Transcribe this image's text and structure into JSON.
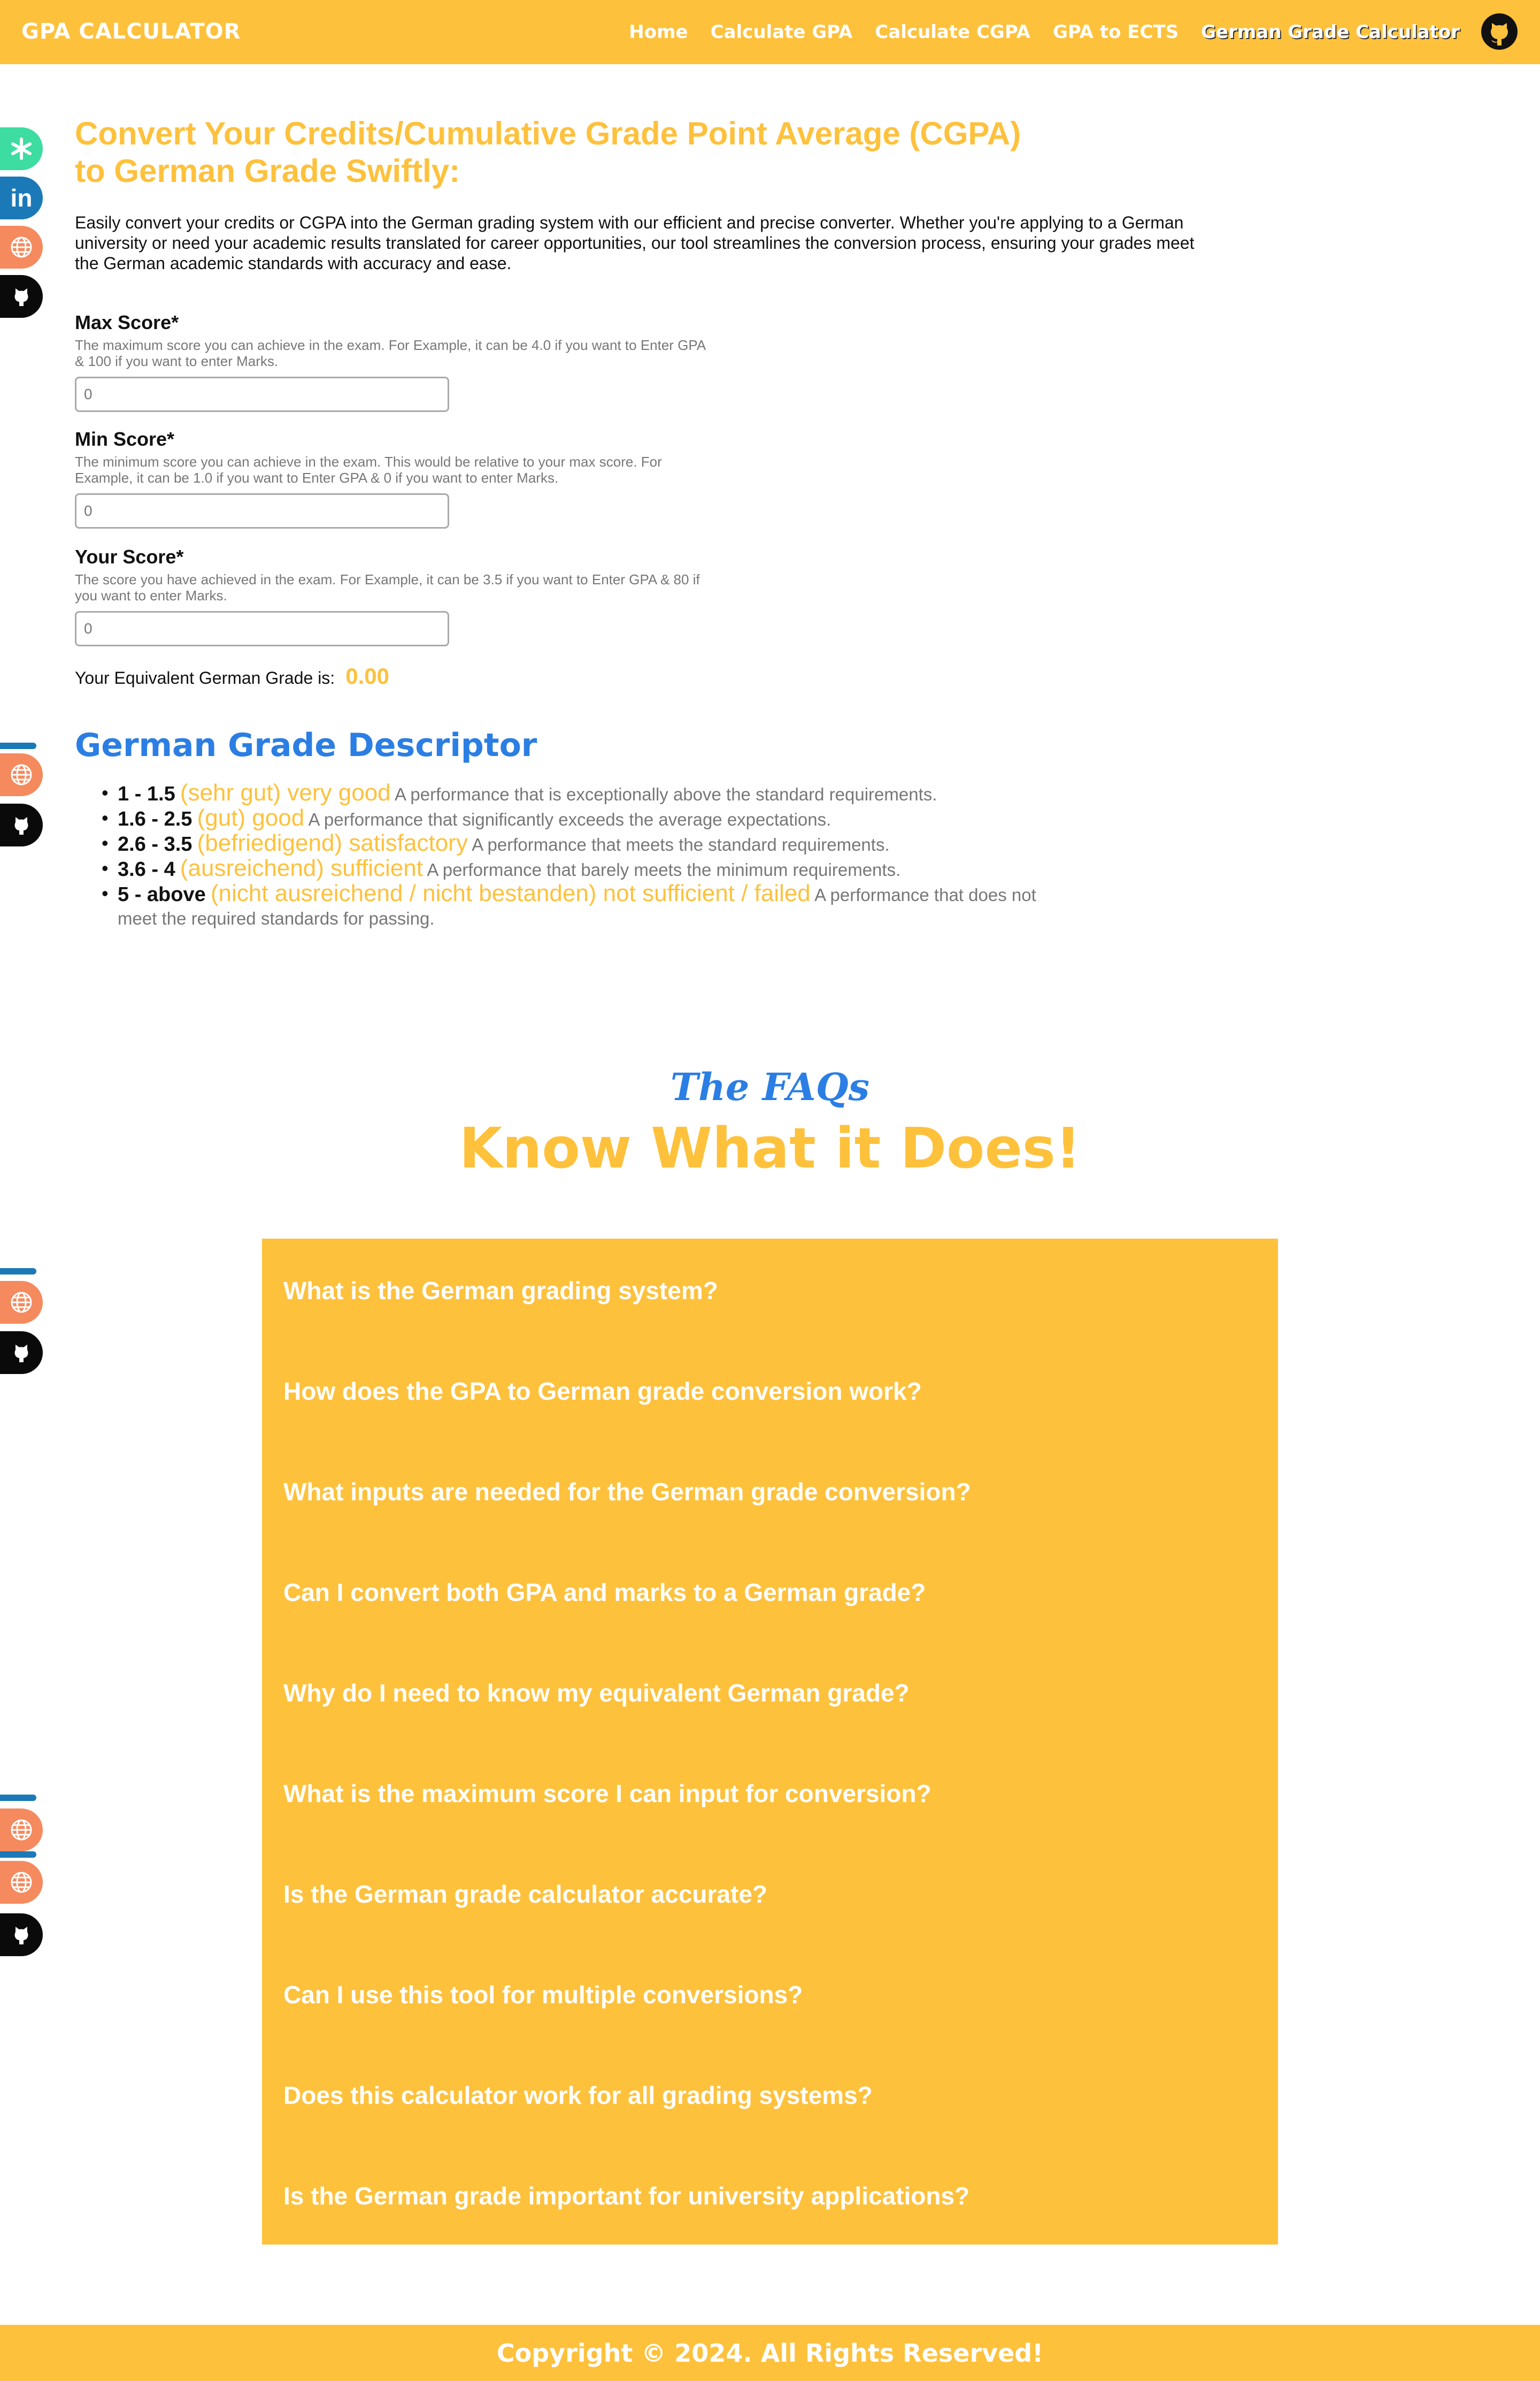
{
  "nav": {
    "brand": "GPA CALCULATOR",
    "links": [
      "Home",
      "Calculate GPA",
      "Calculate CGPA",
      "GPA to ECTS",
      "German Grade Calculator"
    ],
    "active_link": "German Grade Calculator",
    "github_icon": "github-icon"
  },
  "social_icons": [
    "asterisk-icon",
    "linkedin-icon",
    "globe-icon",
    "github-icon"
  ],
  "main": {
    "title_line1": "Convert Your Credits/Cumulative Grade Point Average (CGPA)",
    "title_line2": "to German Grade Swiftly:",
    "intro": "Easily convert your credits or CGPA into the German grading system with our efficient and precise converter. Whether you're applying to a German university or need your academic results translated for career opportunities, our tool streamlines the conversion process, ensuring your grades meet the German academic standards with accuracy and ease."
  },
  "form": {
    "max": {
      "label": "Max Score*",
      "help": "The maximum score you can achieve in the exam. For Example, it can be 4.0 if you want to Enter GPA & 100 if you want to enter Marks.",
      "value": "0"
    },
    "min": {
      "label": "Min Score*",
      "help": "The minimum score you can achieve in the exam. This would be relative to your max score. For Example, it can be 1.0 if you want to Enter GPA & 0 if you want to enter Marks.",
      "value": "0"
    },
    "your": {
      "label": "Your Score*",
      "help": "The score you have achieved in the exam. For Example, it can be 3.5 if you want to Enter GPA & 80 if you want to enter Marks.",
      "value": "0"
    },
    "result_label": "Your Equivalent German Grade is:",
    "result_value": "0.00"
  },
  "descriptor": {
    "title": "German Grade Descriptor",
    "grades": [
      {
        "range": "1 - 1.5",
        "name": "(sehr gut) very good",
        "desc": "A performance that is exceptionally above the standard requirements."
      },
      {
        "range": "1.6 - 2.5",
        "name": "(gut) good",
        "desc": "A performance that significantly exceeds the average expectations."
      },
      {
        "range": "2.6 - 3.5",
        "name": "(befriedigend) satisfactory",
        "desc": "A performance that meets the standard requirements."
      },
      {
        "range": "3.6 - 4",
        "name": "(ausreichend) sufficient",
        "desc": "A performance that barely meets the minimum requirements."
      },
      {
        "range": "5 - above",
        "name": "(nicht ausreichend / nicht bestanden) not sufficient / failed",
        "desc": "A performance that does not meet the required standards for passing."
      }
    ]
  },
  "faq": {
    "kicker": "The FAQs",
    "title": "Know What it Does!",
    "items": [
      "What is the German grading system?",
      "How does the GPA to German grade conversion work?",
      "What inputs are needed for the German grade conversion?",
      "Can I convert both GPA and marks to a German grade?",
      "Why do I need to know my equivalent German grade?",
      "What is the maximum score I can input for conversion?",
      "Is the German grade calculator accurate?",
      "Can I use this tool for multiple conversions?",
      "Does this calculator work for all grading systems?",
      "Is the German grade important for university applications?"
    ]
  },
  "footer": {
    "text": "Copyright © 2024. All Rights Reserved!"
  },
  "colors": {
    "accent": "#FEC13C",
    "blue": "#2B7EE3",
    "linkedin": "#1C79B8",
    "social_green": "#3DDCA0",
    "social_orange": "#F58A5E"
  }
}
